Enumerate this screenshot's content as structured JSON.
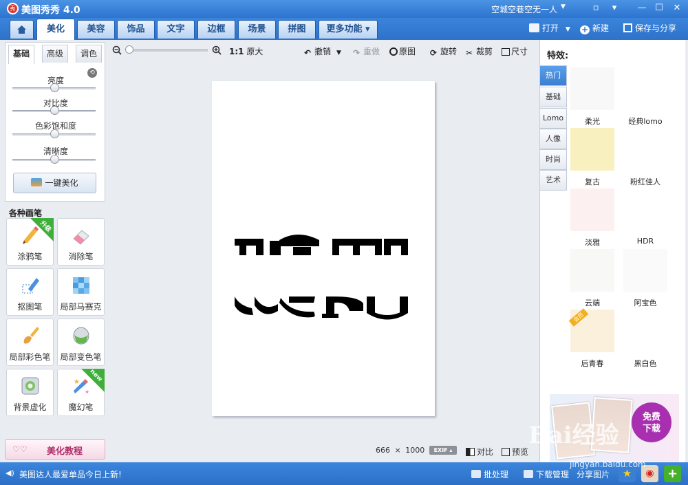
{
  "app": {
    "title": "美图秀秀 4.0",
    "logo_text": "秀",
    "user": "空城空巷空无一人"
  },
  "tabs": [
    {
      "label": "美化"
    },
    {
      "label": "美容"
    },
    {
      "label": "饰品"
    },
    {
      "label": "文字"
    },
    {
      "label": "边框"
    },
    {
      "label": "场景"
    },
    {
      "label": "拼图"
    },
    {
      "label": "更多功能 ▾"
    }
  ],
  "top_actions": {
    "open": "打开",
    "new": "新建",
    "save": "保存与分享"
  },
  "subtabs": [
    {
      "label": "基础"
    },
    {
      "label": "高级"
    },
    {
      "label": "调色"
    }
  ],
  "sliders": [
    {
      "label": "亮度",
      "value": 0.5
    },
    {
      "label": "对比度",
      "value": 0.5
    },
    {
      "label": "色彩饱和度",
      "value": 0.5
    },
    {
      "label": "清晰度",
      "value": 0.5
    }
  ],
  "one_click": "一键美化",
  "brushes_title": "各种画笔",
  "brushes": [
    {
      "label": "涂鸦笔",
      "ribbon": "升级"
    },
    {
      "label": "消除笔",
      "ribbon": ""
    },
    {
      "label": "抠图笔",
      "ribbon": ""
    },
    {
      "label": "局部马赛克",
      "ribbon": ""
    },
    {
      "label": "局部彩色笔",
      "ribbon": ""
    },
    {
      "label": "局部变色笔",
      "ribbon": ""
    },
    {
      "label": "背景虚化",
      "ribbon": ""
    },
    {
      "label": "魔幻笔",
      "ribbon": "new"
    }
  ],
  "tutorial": "美化教程",
  "toolbar": {
    "ratio": "1:1",
    "original_size": "原大",
    "undo": "撤销",
    "redo": "重做",
    "original": "原图",
    "rotate": "旋转",
    "crop": "裁剪",
    "size": "尺寸"
  },
  "zoom_level": 0.0,
  "image_info": {
    "width": "666",
    "times": "×",
    "height": "1000",
    "exif": "EXIF ▴",
    "compare": "对比",
    "preview": "预览"
  },
  "effects_title": "特效:",
  "effect_categories": [
    "热门",
    "基础",
    "Lomo",
    "人像",
    "时尚",
    "艺术"
  ],
  "effects": [
    {
      "label": "柔光",
      "color": "#f8f8f8",
      "badge": ""
    },
    {
      "label": "经典lomo",
      "color": "#ffffff",
      "badge": ""
    },
    {
      "label": "复古",
      "color": "#f9f0c0",
      "badge": ""
    },
    {
      "label": "粉红佳人",
      "color": "#ffffff",
      "badge": ""
    },
    {
      "label": "淡雅",
      "color": "#fdf0f0",
      "badge": ""
    },
    {
      "label": "HDR",
      "color": "#ffffff",
      "badge": ""
    },
    {
      "label": "云端",
      "color": "#f8f8f6",
      "badge": ""
    },
    {
      "label": "阿宝色",
      "color": "#fafafa",
      "badge": ""
    },
    {
      "label": "后青春",
      "color": "#fbf0dc",
      "badge": "会员"
    },
    {
      "label": "黑白色",
      "color": "#ffffff",
      "badge": ""
    }
  ],
  "ad": {
    "badge_line1": "免费",
    "badge_line2": "下载"
  },
  "status": {
    "news": "美图达人最爱单品今日上新!",
    "batch": "批处理",
    "download": "下载管理",
    "share": "分享图片"
  },
  "watermark": {
    "brand": "Bai经验",
    "url": "jingyan.baidu.com"
  },
  "colors": {
    "accent": "#2f74c8",
    "tab_active": "#ffffff",
    "ribbon_green": "#3fae3a",
    "ad_purple": "#a830b0"
  }
}
